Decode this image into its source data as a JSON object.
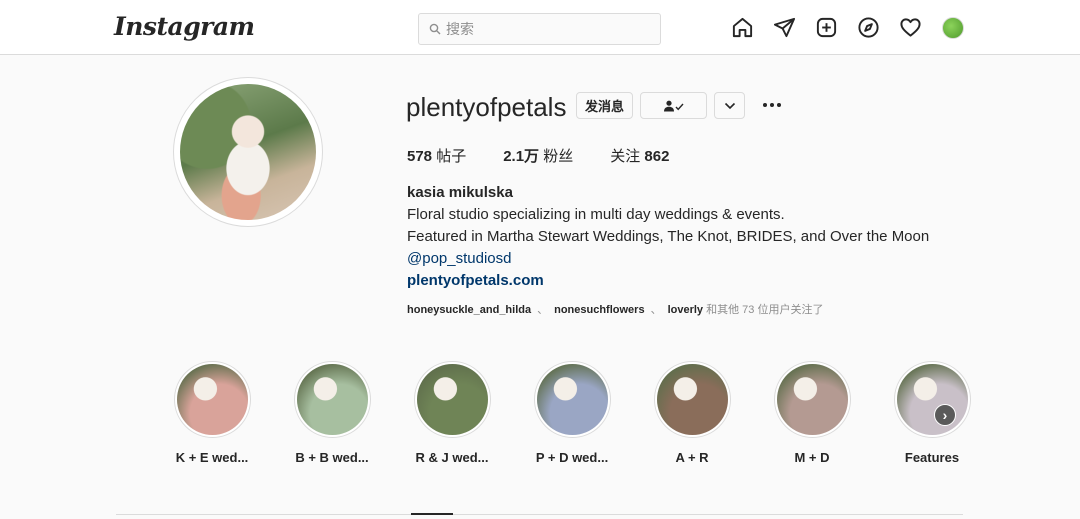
{
  "nav": {
    "logo": "Instagram",
    "search_placeholder": "搜索",
    "icons": [
      "home-icon",
      "direct-icon",
      "new-post-icon",
      "explore-icon",
      "activity-icon",
      "profile-avatar"
    ]
  },
  "profile": {
    "username": "plentyofpetals",
    "message_button": "发消息",
    "posts_count": "578",
    "posts_label": " 帖子",
    "followers_count": "2.1万",
    "followers_label": " 粉丝",
    "following_label": "关注 ",
    "following_count": "862",
    "full_name": "kasia mikulska",
    "bio_line1": "Floral studio specializing in multi day weddings & events.",
    "bio_line2": "Featured in Martha Stewart Weddings, The Knot, BRIDES, and Over the Moon",
    "mention": "@pop_studiosd",
    "website": "plentyofpetals.com",
    "followed_by_1": "honeysuckle_and_hilda",
    "followed_sep": "、",
    "followed_by_2": "nonesuchflowers",
    "followed_by_3": "loverly",
    "followed_rest": " 和其他 73 位用户关注了"
  },
  "highlights": [
    {
      "label": "K + E wed...",
      "color": "#d9a39a"
    },
    {
      "label": "B + B wed...",
      "color": "#a7bfa0"
    },
    {
      "label": "R & J wed...",
      "color": "#6f8456"
    },
    {
      "label": "P + D wed...",
      "color": "#9aa6c4"
    },
    {
      "label": "A + R",
      "color": "#8a6d5a"
    },
    {
      "label": "M + D",
      "color": "#b49a92"
    },
    {
      "label": "Features",
      "color": "#c9c0c8"
    }
  ],
  "colors": {
    "link": "#00376b",
    "text": "#262626",
    "muted": "#8e8e8e",
    "border": "#dbdbdb"
  }
}
